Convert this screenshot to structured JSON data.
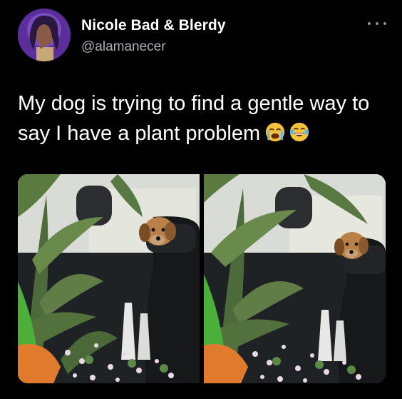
{
  "tweet": {
    "display_name": "Nicole Bad & Blerdy",
    "handle": "@alamanecer",
    "text": "My dog is trying to find a gentle way to say I have a plant problem",
    "emojis": [
      "loudly-crying-face-emoji",
      "face-with-tears-of-joy-emoji"
    ],
    "icons": {
      "more": "more-options-icon",
      "avatar": "user-avatar"
    },
    "colors": {
      "background": "#000000",
      "text": "#ffffff",
      "secondary": "#a9b0b8"
    }
  },
  "media": {
    "photos": [
      {
        "name": "photo-left"
      },
      {
        "name": "photo-right"
      }
    ]
  }
}
